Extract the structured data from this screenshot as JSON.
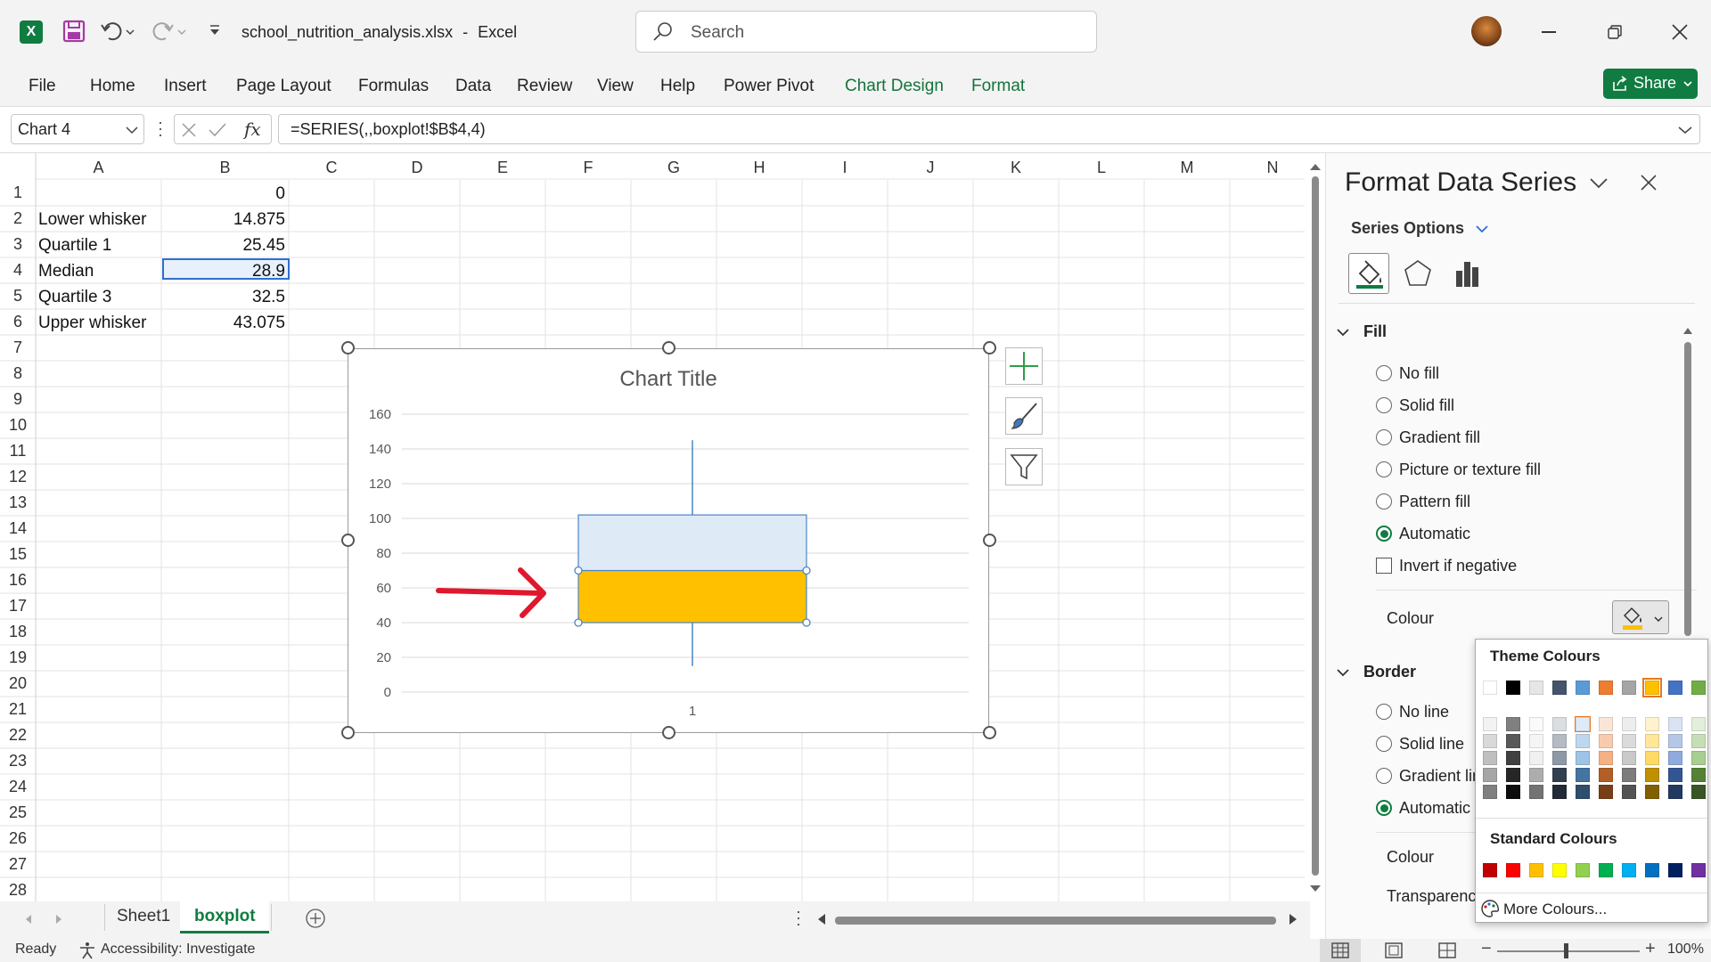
{
  "window": {
    "filename": "school_nutrition_analysis.xlsx",
    "separator": "-",
    "app": "Excel"
  },
  "search": {
    "placeholder": "Search"
  },
  "ribbon_tabs": [
    "File",
    "Home",
    "Insert",
    "Page Layout",
    "Formulas",
    "Data",
    "Review",
    "View",
    "Help",
    "Power Pivot",
    "Chart Design",
    "Format"
  ],
  "share_label": "Share",
  "formula_bar": {
    "name_box": "Chart 4",
    "formula": "=SERIES(,,boxplot!$B$4,4)"
  },
  "columns": [
    "A",
    "B",
    "C",
    "D",
    "E",
    "F",
    "G",
    "H",
    "I",
    "J",
    "K",
    "L",
    "M",
    "N"
  ],
  "rows": [
    "1",
    "2",
    "3",
    "4",
    "5",
    "6",
    "7",
    "8",
    "9",
    "10",
    "11",
    "12",
    "13",
    "14",
    "15",
    "16",
    "17",
    "18",
    "19",
    "20",
    "21",
    "22",
    "23",
    "24",
    "25",
    "26",
    "27",
    "28"
  ],
  "cells": {
    "b1": "0",
    "a2": "Lower whisker",
    "b2": "14.875",
    "a3": "Quartile 1",
    "b3": "25.45",
    "a4": "Median",
    "b4": "28.9",
    "a5": "Quartile 3",
    "b5": "32.5",
    "a6": "Upper whisker",
    "b6": "43.075"
  },
  "chart_data": {
    "type": "bar",
    "title": "Chart Title",
    "categories": [
      "1"
    ],
    "yticks": [
      "0",
      "20",
      "40",
      "60",
      "80",
      "100",
      "120",
      "140",
      "160"
    ],
    "ylim": [
      0,
      160
    ],
    "boxes": [
      {
        "from": 40,
        "to": 70,
        "color": "#ffc000"
      },
      {
        "from": 70,
        "to": 102,
        "color": "#deebf7"
      }
    ],
    "whisker": {
      "low": 15,
      "high": 145
    }
  },
  "sheet_tabs": [
    "Sheet1",
    "boxplot"
  ],
  "status": {
    "ready": "Ready",
    "accessibility": "Accessibility: Investigate",
    "zoom": "100%"
  },
  "pane": {
    "title": "Format Data Series",
    "series_options": "Series Options",
    "fill_section": "Fill",
    "fill_options": [
      "No fill",
      "Solid fill",
      "Gradient fill",
      "Picture or texture fill",
      "Pattern fill",
      "Automatic"
    ],
    "invert_label": "Invert if negative",
    "colour_label": "Colour",
    "border_section": "Border",
    "border_options": [
      "No line",
      "Solid line",
      "Gradient lin",
      "Automatic"
    ],
    "colour2_label": "Colour",
    "transparency_label": "Transparency"
  },
  "colour_popup": {
    "theme_title": "Theme Colours",
    "theme_colors": [
      "#ffffff",
      "#000000",
      "#e7e6e6",
      "#44546a",
      "#5b9bd5",
      "#ed7d31",
      "#a5a5a5",
      "#ffc000",
      "#4472c4",
      "#70ad47"
    ],
    "standard_title": "Standard Colours",
    "standard_colors": [
      "#c00000",
      "#ff0000",
      "#ffc000",
      "#ffff00",
      "#92d050",
      "#00b050",
      "#00b0f0",
      "#0070c0",
      "#002060",
      "#7030a0"
    ],
    "more": "More Colours..."
  },
  "accent": "#107c41"
}
